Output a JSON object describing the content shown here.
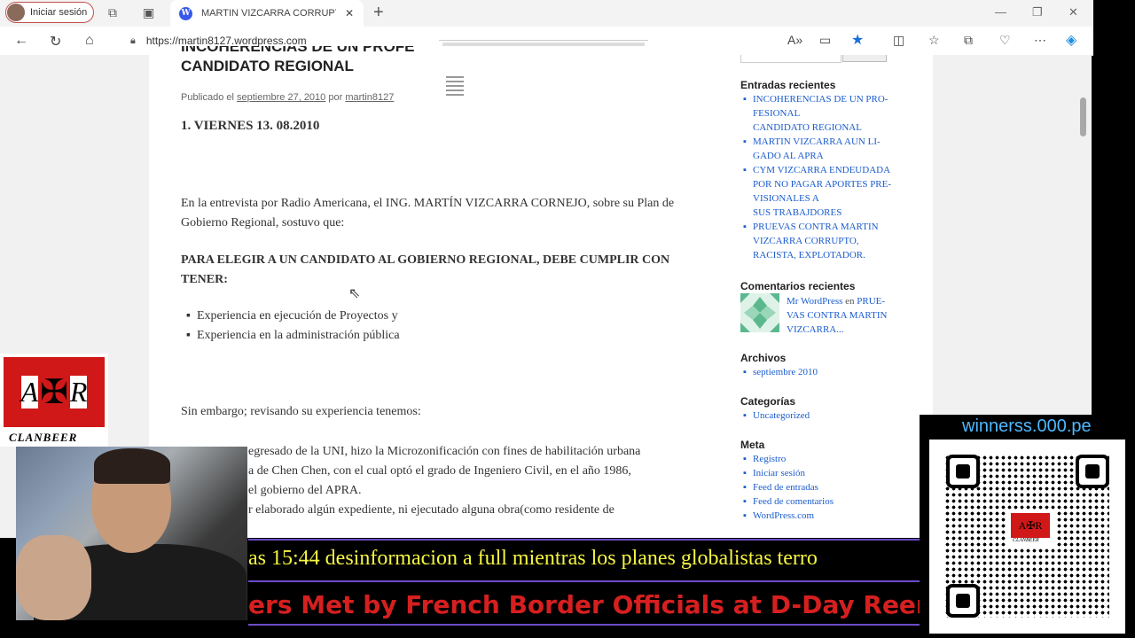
{
  "browser": {
    "signin_label": "Iniciar sesión",
    "tab_title": "MARTIN VIZCARRA CORRUPTO, R",
    "url": "https://martin8127.wordpress.com",
    "new_tab": "+",
    "tab_close": "✕"
  },
  "post": {
    "title_line1": "INCOHERENCIAS DE UN PROFE",
    "title_line2": "CANDIDATO REGIONAL",
    "meta_prefix": "Publicado el",
    "meta_date": "septiembre 27, 2010",
    "meta_by": "por",
    "meta_author": "martin8127",
    "item1": "1.    VIERNES 13. 08.2010",
    "para1": "En la entrevista por Radio Americana, el ING. MARTÍN VIZCARRA CORNEJO, sobre su Plan de Gobierno Regional, sostuvo que:",
    "bold_para": "PARA ELEGIR A UN CANDIDATO AL GOBIERNO REGIONAL, DEBE CUMPLIR CON TENER:",
    "bullets": [
      "Experiencia en ejecución de Proyectos y",
      "Experiencia en la administración pública"
    ],
    "para3": "Sin embargo; revisando su experiencia tenemos:",
    "para4_line1": "egresado de la UNI, hizo la Microzonificación con fines de habilitación urbana",
    "para4_line2": "a de Chen Chen, con el cual optó el grado de Ingeniero Civil, en el año 1986,",
    "para4_line3": "el gobierno del APRA.",
    "para4_line4": "r elaborado algún expediente,  ni ejecutado alguna obra(como residente de"
  },
  "sidebar": {
    "recent_posts_title": "Entradas recientes",
    "recent_posts": [
      "INCOHERENCIAS DE UN PRO-",
      "FESIONAL",
      "CANDIDATO REGIONAL",
      "MARTIN VIZCARRA AUN LI-",
      "GADO AL APRA",
      "CYM VIZCARRA ENDEUDADA",
      "POR NO PAGAR APORTES PRE-",
      "VISIONALES A",
      "SUS TRABAJDORES",
      "PRUEVAS CONTRA MARTIN",
      "VIZCARRA CORRUPTO,",
      "RACISTA, EXPLOTADOR."
    ],
    "recent_comments_title": "Comentarios recientes",
    "comment_author": "Mr WordPress",
    "comment_en": "en",
    "comment_line1_post": "PRUE-",
    "comment_line2": "VAS CONTRA MARTIN",
    "comment_line3": "VIZCARRA...",
    "archives_title": "Archivos",
    "archives": [
      "septiembre 2010"
    ],
    "categories_title": "Categorías",
    "categories": [
      "Uncategorized"
    ],
    "meta_title": "Meta",
    "meta_links": [
      "Registro",
      "Iniciar sesión",
      "Feed de entradas",
      "Feed de comentarios",
      "WordPress.com"
    ]
  },
  "overlay": {
    "logo_left": "A",
    "logo_right": "R",
    "logo_text": "CLANBEER",
    "qr_url": "winnerss.000.pe",
    "qr_logo_text": "CLANBEER",
    "ticker1": "as 15:44 desinformacion a full mientras los planes globalistas terro",
    "ticker2": "ers Met by French Border Officials at D-Day Reena"
  }
}
